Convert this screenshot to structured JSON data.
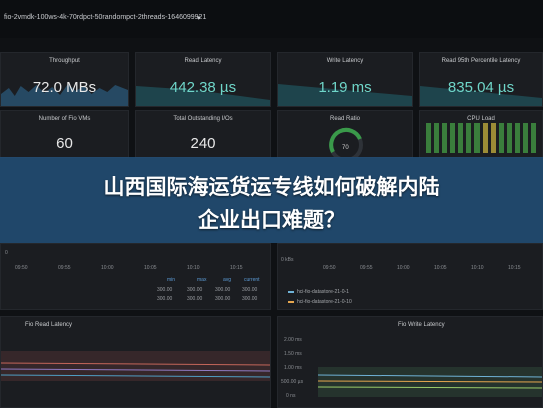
{
  "dashboard": {
    "title": "fio-2vmdk-100ws-4k-70rdpct-50randompct-2threads-1646099921",
    "caret": "▾"
  },
  "row1": {
    "throughput": {
      "title": "Throughput",
      "value": "72.0 MBs"
    },
    "read_latency": {
      "title": "Read Latency",
      "value": "442.38 µs"
    },
    "write_latency": {
      "title": "Write Latency",
      "value": "1.19 ms"
    },
    "read_p95": {
      "title": "Read 95th Percentile Latency",
      "value": "835.04 µs"
    }
  },
  "row2": {
    "fio_vms": {
      "title": "Number of Fio VMs",
      "value": "60"
    },
    "outstanding_io": {
      "title": "Total Outstanding I/Os",
      "value": "240"
    },
    "read_ratio": {
      "title": "Read Ratio",
      "value": "70"
    },
    "cpu_load": {
      "title": "CPU Load"
    }
  },
  "banner": {
    "line1": "山西国际海运货运专线如何破解内陆",
    "line2": "企业出口难题？"
  },
  "graphs_left": {
    "time_ticks": [
      "09:50",
      "09:55",
      "10:00",
      "10:05",
      "10:10",
      "10:15"
    ],
    "y_tick": "0",
    "table_headers": [
      "min",
      "max",
      "avg",
      "current"
    ],
    "table_rows": [
      [
        "300.00",
        "300.00",
        "300.00",
        "300.00"
      ],
      [
        "300.00",
        "300.00",
        "300.00",
        "300.00"
      ]
    ]
  },
  "graphs_right": {
    "y_tick": "0 kBs",
    "time_ticks": [
      "09:50",
      "09:55",
      "10:00",
      "10:05",
      "10:10",
      "10:15"
    ],
    "legend": [
      "hci-fio-datastore-21-0-1",
      "hci-fio-datastore-21-0-10"
    ]
  },
  "bottom": {
    "left_title": "Fio Read Latency",
    "right_title": "Fio Write Latency",
    "right_yticks": [
      "2.00 ms",
      "1.50 ms",
      "1.00 ms",
      "500.00 µs",
      "0 ns"
    ]
  },
  "colors": {
    "accent_teal": "#6fd6c9",
    "banner_blue": "#234e76",
    "panel_bg": "#1b1d21",
    "cpu_green": "#3a7e3c"
  }
}
